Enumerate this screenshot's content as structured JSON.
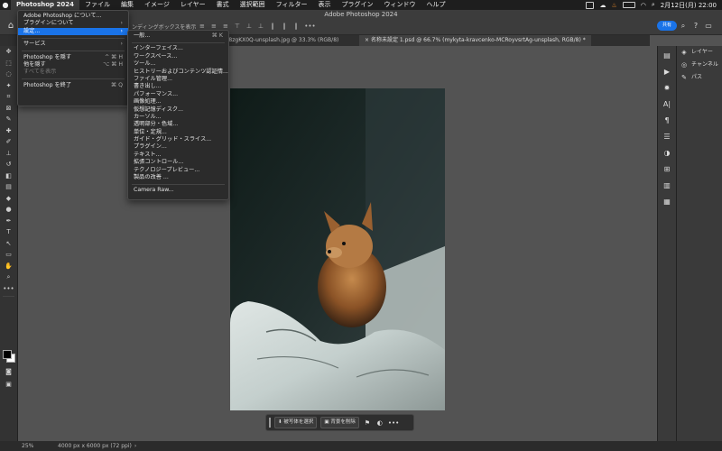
{
  "menubar": {
    "app_name": "Photoshop 2024",
    "items": [
      "ファイル",
      "編集",
      "イメージ",
      "レイヤー",
      "書式",
      "選択範囲",
      "フィルター",
      "表示",
      "プラグイン",
      "ウィンドウ",
      "ヘルプ"
    ],
    "clock": "2月12日(月) 22:00"
  },
  "window": {
    "title": "Adobe Photoshop 2024"
  },
  "options_bar": {
    "label": "ンディングボックスを表示",
    "share_label": "共有",
    "more": "•••"
  },
  "tabs": [
    {
      "label": "a-dGFY8zgKX0Q-unsplash.jpg @ 33.3% (RGB/8)"
    },
    {
      "label": "名称未設定 1.psd @ 66.7% (mykyta-kravcenko-MCRoyvsrtAg-unsplash, RGB/8) *"
    }
  ],
  "app_menu": {
    "items": [
      {
        "label": "Adobe Photoshop について...",
        "shortcut": ""
      },
      {
        "label": "プラグインについて",
        "shortcut": "›"
      },
      {
        "label": "設定...",
        "shortcut": "›"
      },
      {
        "label": "サービス",
        "shortcut": "›"
      },
      {
        "label": "Photoshop を隠す",
        "shortcut": "^ ⌘ H"
      },
      {
        "label": "他を隠す",
        "shortcut": "⌥ ⌘ H"
      },
      {
        "label": "すべてを表示",
        "shortcut": ""
      },
      {
        "label": "Photoshop を終了",
        "shortcut": "⌘ Q"
      }
    ]
  },
  "settings_submenu": {
    "items": [
      {
        "label": "一般...",
        "shortcut": "⌘ K"
      },
      {
        "label": "インターフェイス..."
      },
      {
        "label": "ワークスペース..."
      },
      {
        "label": "ツール..."
      },
      {
        "label": "ヒストリーおよびコンテンツ認証情..."
      },
      {
        "label": "ファイル管理..."
      },
      {
        "label": "書き出し..."
      },
      {
        "label": "パフォーマンス..."
      },
      {
        "label": "画像処理..."
      },
      {
        "label": "仮想記憶ディスク..."
      },
      {
        "label": "カーソル..."
      },
      {
        "label": "透明部分・色域..."
      },
      {
        "label": "単位・定規..."
      },
      {
        "label": "ガイド・グリッド・スライス..."
      },
      {
        "label": "プラグイン..."
      },
      {
        "label": "テキスト..."
      },
      {
        "label": "拡張コントロール..."
      },
      {
        "label": "テクノロジープレビュー..."
      },
      {
        "label": "製品の改善 ..."
      },
      {
        "label": "Camera Raw..."
      }
    ]
  },
  "panels": {
    "layers": "レイヤー",
    "channels": "チャンネル",
    "paths": "パス"
  },
  "context_bar": {
    "select_subject": "被写体を選択",
    "remove_background": "背景を削除",
    "more": "•••"
  },
  "statusbar": {
    "zoom": "25%",
    "doc_size": "4000 px x 6000 px (72 ppi)"
  },
  "colors": {
    "highlight": "#1a73e8",
    "menubar": "#1e1e1e",
    "canvas_bg": "#535353"
  }
}
